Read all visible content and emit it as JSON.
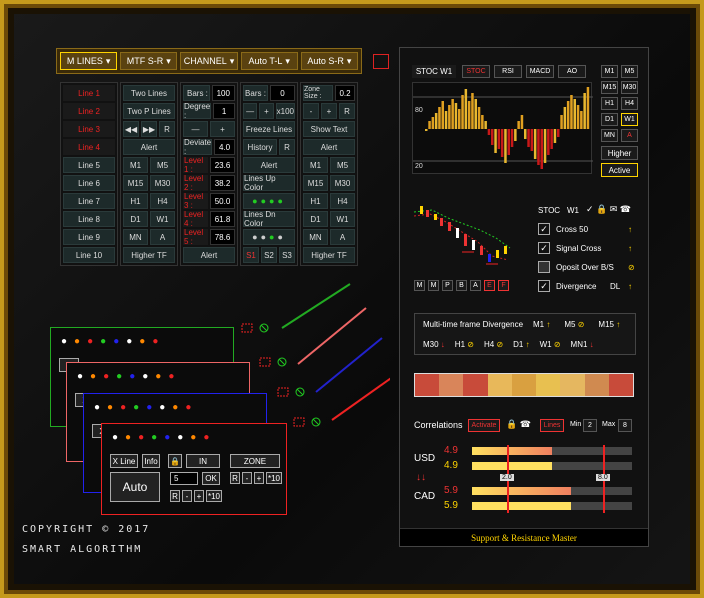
{
  "toolbar": {
    "m_lines": "M LINES",
    "mtf": "MTF S-R",
    "channel": "CHANNEL",
    "auto_tl": "Auto T-L",
    "auto_sr": "Auto S-R",
    "caret": "▾"
  },
  "col1": [
    "Line 1",
    "Line 2",
    "Line 3",
    "Line 4",
    "Line 5",
    "Line 6",
    "Line 7",
    "Line 8",
    "Line 9",
    "Line 10"
  ],
  "col2": {
    "two_lines": "Two Lines",
    "two_p_lines": "Two P Lines",
    "rw": "◀◀",
    "ff": "▶▶",
    "r": "R",
    "alert": "Alert",
    "m1": "M1",
    "m5": "M5",
    "m15": "M15",
    "m30": "M30",
    "h1": "H1",
    "h4": "H4",
    "d1": "D1",
    "w1": "W1",
    "mn": "MN",
    "a": "A",
    "higher_tf": "Higher TF"
  },
  "col3": {
    "bars_label": "Bars :",
    "bars_value": "100",
    "degree_label": "Degree :",
    "degree_value": "1",
    "minus": "—",
    "plus": "+",
    "deviate_label": "Deviate :",
    "deviate_value": "4.0",
    "levels": [
      {
        "label": "Level 1 :",
        "value": "23.6"
      },
      {
        "label": "Level 2 :",
        "value": "38.2"
      },
      {
        "label": "Level 3 :",
        "value": "50.0"
      },
      {
        "label": "Level 4 :",
        "value": "61.8"
      },
      {
        "label": "Level 5 :",
        "value": "78.6"
      }
    ],
    "alert": "Alert"
  },
  "col4": {
    "bars_label": "Bars :",
    "bars_value": "0",
    "minus": "—",
    "plus": "+",
    "x100": "x100",
    "freeze": "Freeze Lines",
    "history": "History",
    "r": "R",
    "alert": "Alert",
    "lines_up": "Lines Up Color",
    "lines_dn": "Lines Dn Color",
    "s1": "S1",
    "s2": "S2",
    "s3": "S3"
  },
  "col5": {
    "zone_label": "Zone Size :",
    "zone_value": "0.2",
    "minus": "-",
    "plus": "+",
    "r": "R",
    "show_text": "Show Text",
    "alert": "Alert",
    "m1": "M1",
    "m5": "M5",
    "m15": "M15",
    "m30": "M30",
    "h1": "H1",
    "h4": "H4",
    "d1": "D1",
    "w1": "W1",
    "mn": "MN",
    "a": "A",
    "higher_tf": "Higher TF"
  },
  "panel": {
    "stoc_title": "STOC W1",
    "tabs": [
      "STOC",
      "RSI",
      "MACD",
      "AO"
    ],
    "level_80": "80",
    "level_20": "20",
    "tf_grid": [
      [
        "M1",
        "M5"
      ],
      [
        "M15",
        "M30"
      ],
      [
        "H1",
        "H4"
      ],
      [
        "D1",
        "W1"
      ],
      [
        "MN",
        "A"
      ]
    ],
    "higher": "Higher",
    "active": "Active",
    "stoc_label": "STOC",
    "stoc_tf": "W1",
    "options": [
      {
        "label": "Cross 50",
        "checked": true,
        "extra": "",
        "arrow": "↑"
      },
      {
        "label": "Signal Cross",
        "checked": true,
        "extra": "",
        "arrow": "↑"
      },
      {
        "label": "Oposit Over B/S",
        "checked": false,
        "extra": "",
        "arrow": "⊘"
      },
      {
        "label": "Divergence",
        "checked": true,
        "extra": "DL",
        "arrow": "↑"
      }
    ],
    "mini_letters": [
      "M",
      "M",
      "P",
      "B",
      "A",
      "E",
      "F"
    ],
    "mtf_title": "Multi-time frame Divergence",
    "mtf_row1": [
      {
        "tf": "M1",
        "sig": "↑"
      },
      {
        "tf": "M5",
        "sig": "⊘"
      },
      {
        "tf": "M15",
        "sig": "↑"
      }
    ],
    "mtf_row0": [
      {
        "tf": "M30",
        "sig": "↓"
      }
    ],
    "mtf_row2": [
      {
        "tf": "H1",
        "sig": "⊘"
      },
      {
        "tf": "H4",
        "sig": "⊘"
      },
      {
        "tf": "D1",
        "sig": "↑"
      },
      {
        "tf": "W1",
        "sig": "⊘"
      },
      {
        "tf": "MN1",
        "sig": "↓"
      }
    ],
    "correlations": "Correlations",
    "activate": "Activate",
    "lines": "Lines",
    "min_label": "Min",
    "min_value": "2",
    "max_label": "Max",
    "max_value": "8",
    "usd": "USD",
    "cad": "CAD",
    "usd_vals": [
      "4.9",
      "4.9"
    ],
    "cad_vals": [
      "5.9",
      "5.9"
    ],
    "axis_2": "2.0",
    "axis_8": "8.0",
    "footer": "Support & Resistance Master"
  },
  "windows": {
    "x_line": "X Line",
    "info": "Info",
    "in": "IN",
    "zone": "ZONE",
    "auto": "Auto",
    "field_value": "5",
    "ok": "OK",
    "r": "R",
    "minus": "-",
    "plus": "+",
    "x10": "*10",
    "x_line_short": "X"
  },
  "copyright": {
    "line1": "COPYRIGHT © 2017",
    "line2": "SMART ALGORITHM"
  }
}
